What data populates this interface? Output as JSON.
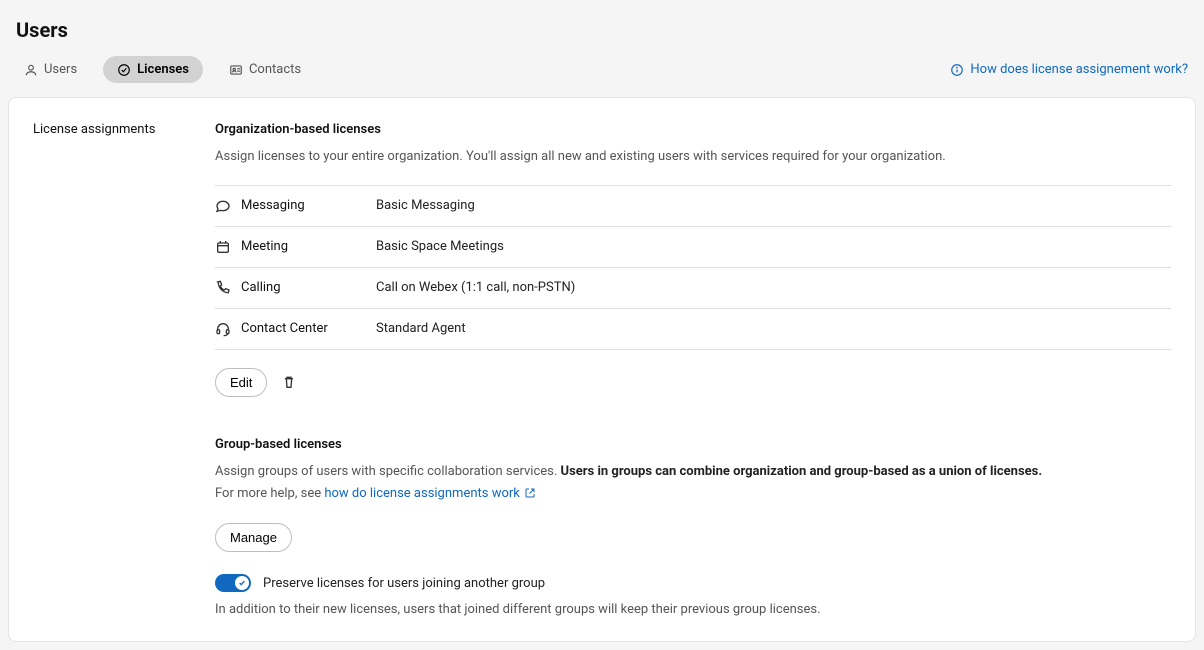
{
  "header": {
    "title": "Users"
  },
  "tabs": {
    "users": "Users",
    "licenses": "Licenses",
    "contacts": "Contacts"
  },
  "help_link": "How does license assignement work?",
  "left_label": "License assignments",
  "org": {
    "title": "Organization-based licenses",
    "desc": "Assign licenses to your entire organization. You'll assign all new and existing users with services required for your organization.",
    "rows": [
      {
        "name": "Messaging",
        "value": "Basic Messaging"
      },
      {
        "name": "Meeting",
        "value": "Basic Space Meetings"
      },
      {
        "name": "Calling",
        "value": "Call on Webex (1:1 call, non-PSTN)"
      },
      {
        "name": "Contact Center",
        "value": "Standard Agent"
      }
    ],
    "edit_btn": "Edit"
  },
  "group": {
    "title": "Group-based licenses",
    "desc_plain": "Assign groups of users with specific collaboration services. ",
    "desc_bold": "Users in groups can combine organization and group-based as a union of licenses.",
    "help_prefix": "For more help, see ",
    "help_link": "how do license assignments work",
    "manage_btn": "Manage",
    "toggle_label": "Preserve licenses for users joining another group",
    "toggle_desc": "In addition to their new licenses, users that joined different groups will keep their previous group licenses."
  }
}
